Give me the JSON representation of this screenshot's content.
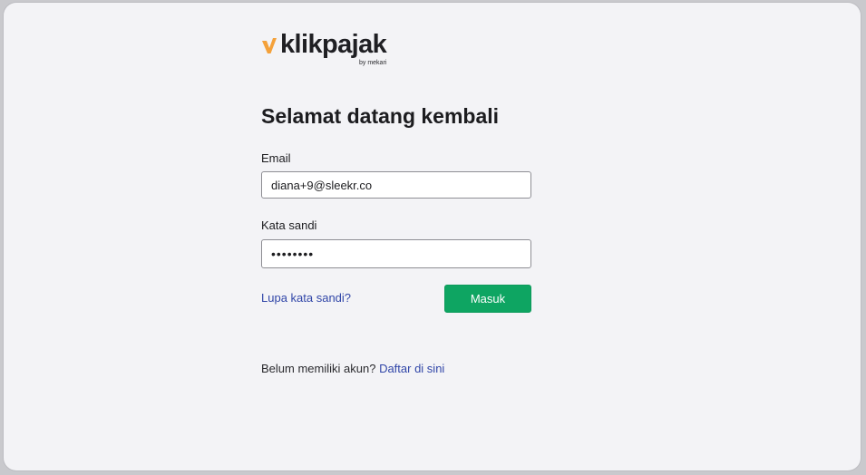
{
  "brand": {
    "name": "klikpajak",
    "tagline": "by mekari",
    "mark_color": "#f4a13a"
  },
  "login": {
    "title": "Selamat datang kembali",
    "email_label": "Email",
    "email_value": "diana+9@sleekr.co",
    "password_label": "Kata sandi",
    "password_value": "••••••••",
    "forgot_link": "Lupa kata sandi?",
    "submit_label": "Masuk",
    "submit_color": "#0ea562"
  },
  "signup": {
    "prompt": "Belum memiliki akun?",
    "link": "Daftar di sini",
    "link_color": "#3146a8"
  },
  "icons": {
    "brand_mark": "checkmark-logo-icon"
  }
}
